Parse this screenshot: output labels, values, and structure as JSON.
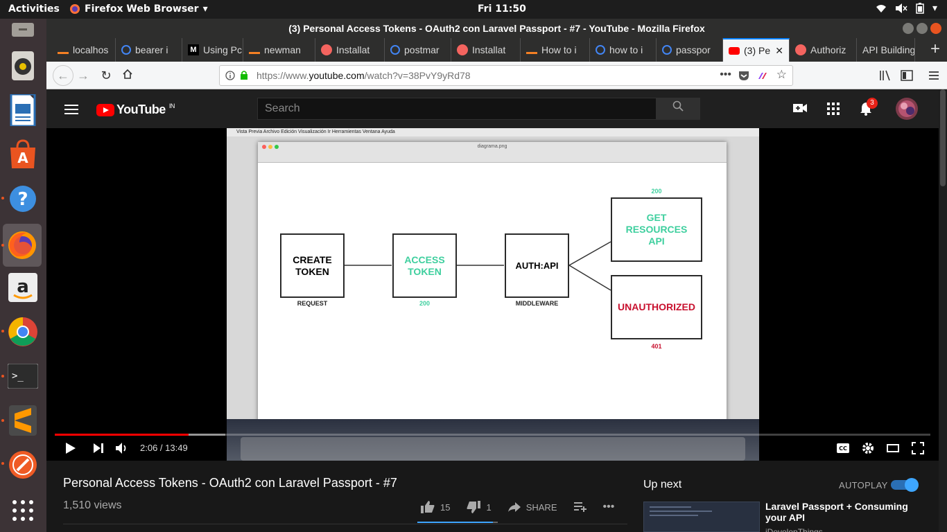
{
  "topbar": {
    "activities": "Activities",
    "app_menu": "Firefox Web Browser",
    "clock": "Fri 11:50"
  },
  "launcher": {
    "apps": [
      "files-icon",
      "rhythmbox-icon",
      "libreoffice-writer-icon",
      "ubuntu-software-icon",
      "help-icon",
      "firefox-icon",
      "amazon-icon",
      "chrome-icon",
      "terminal-icon",
      "sublime-text-icon",
      "postman-icon",
      "show-apps-icon"
    ]
  },
  "firefox": {
    "window_title": "(3) Personal Access Tokens - OAuth2 con Laravel Passport - #7 - YouTube - Mozilla Firefox",
    "tabs": [
      {
        "label": "localhos",
        "icon": "stackoverflow-icon"
      },
      {
        "label": "bearer i",
        "icon": "google-icon"
      },
      {
        "label": "Using Pc",
        "icon": "medium-icon"
      },
      {
        "label": "newman",
        "icon": "stackoverflow-icon"
      },
      {
        "label": "Installat",
        "icon": "laravel-icon"
      },
      {
        "label": "postmar",
        "icon": "google-icon"
      },
      {
        "label": "Installat",
        "icon": "laravel-icon"
      },
      {
        "label": "How to i",
        "icon": "stackoverflow-icon"
      },
      {
        "label": "how to i",
        "icon": "google-icon"
      },
      {
        "label": "passpor",
        "icon": "google-icon"
      },
      {
        "label": "(3) Pe",
        "icon": "youtube-icon",
        "active": true
      },
      {
        "label": "Authoriz",
        "icon": "laravel-icon"
      },
      {
        "label": "API Building",
        "icon": ""
      }
    ],
    "url_prefix": "https://www.",
    "url_domain": "youtube.com",
    "url_path": "/watch?v=38PvY9yRd78"
  },
  "youtube": {
    "logo_text": "YouTube",
    "region": "IN",
    "search_placeholder": "Search",
    "notification_count": "3",
    "colors": {
      "brand_red": "#ff0000",
      "accent_blue": "#3ea6ff"
    }
  },
  "video": {
    "mac_menu": "Vista Previa   Archivo   Edición   Visualización   Ir   Herramientas   Ventana   Ayuda",
    "mac_window_title": "diagrama.png",
    "diagram": {
      "create_token": "CREATE TOKEN",
      "request_label": "REQUEST",
      "access_token": "ACCESS TOKEN",
      "access_status": "200",
      "auth_api": "AUTH:API",
      "middleware_label": "MIDDLEWARE",
      "get_resources": "GET RESOURCES API",
      "get_status": "200",
      "unauthorized": "UNAUTHORIZED",
      "unauth_status": "401",
      "colors": {
        "green": "#3ecf9e",
        "red": "#c8102e"
      }
    },
    "timecode": "2:06 / 13:49",
    "progress_played_fraction": 0.153,
    "progress_loaded_fraction": 0.195
  },
  "below": {
    "title": "Personal Access Tokens - OAuth2 con Laravel Passport - #7",
    "views": "1,510 views",
    "likes": "15",
    "dislikes": "1",
    "share": "SHARE",
    "like_ratio": 0.94,
    "up_next": "Up next",
    "autoplay": "AUTOPLAY",
    "next_video_title": "Laravel Passport + Consuming your API",
    "next_video_channel": "iDevelopThings"
  }
}
